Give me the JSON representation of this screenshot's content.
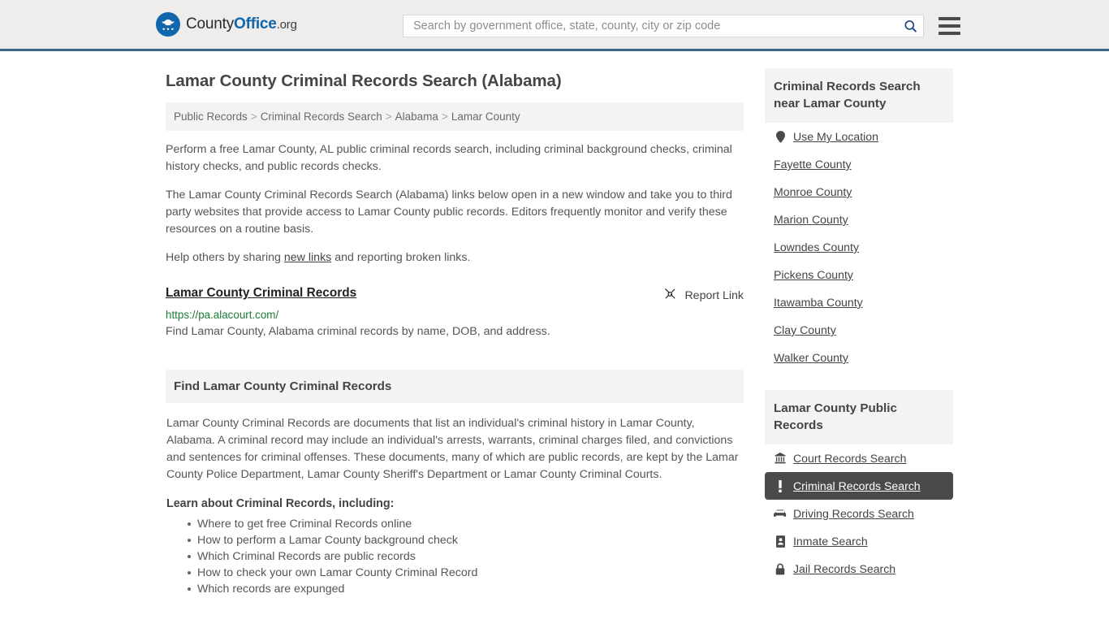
{
  "header": {
    "logo": {
      "icon": "eagle-shield-icon",
      "text_part1": "County",
      "text_part2": "Office",
      "text_part3": ".org"
    },
    "search": {
      "placeholder": "Search by government office, state, county, city or zip code",
      "value": "",
      "search_icon": "search-icon"
    },
    "menu_icon": "hamburger-menu-icon"
  },
  "main": {
    "title": "Lamar County Criminal Records Search (Alabama)",
    "breadcrumb": [
      "Public Records",
      "Criminal Records Search",
      "Alabama",
      "Lamar County"
    ],
    "breadcrumb_separator": ">",
    "intro_paragraph": "Perform a free Lamar County, AL public criminal records search, including criminal background checks, criminal history checks, and public records checks.",
    "second_paragraph": "The Lamar County Criminal Records Search (Alabama) links below open in a new window and take you to third party websites that provide access to Lamar County public records. Editors frequently monitor and verify these resources on a routine basis.",
    "help_prefix": "Help others by sharing ",
    "help_link": "new links",
    "help_suffix": " and reporting broken links.",
    "result": {
      "title": "Lamar County Criminal Records",
      "report_label": "Report Link",
      "report_icon": "broken-link-icon",
      "url": "https://pa.alacourt.com/",
      "description": "Find Lamar County, Alabama criminal records by name, DOB, and address."
    },
    "section": {
      "heading": "Find Lamar County Criminal Records",
      "paragraph": "Lamar County Criminal Records are documents that list an individual's criminal history in Lamar County, Alabama. A criminal record may include an individual's arrests, warrants, criminal charges filed, and convictions and sentences for criminal offenses. These documents, many of which are public records, are kept by the Lamar County Police Department, Lamar County Sheriff's Department or Lamar County Criminal Courts.",
      "learn_heading": "Learn about Criminal Records, including:",
      "learn_items": [
        "Where to get free Criminal Records online",
        "How to perform a Lamar County background check",
        "Which Criminal Records are public records",
        "How to check your own Lamar County Criminal Record",
        "Which records are expunged"
      ]
    }
  },
  "sidebar": {
    "nearby": {
      "heading": "Criminal Records Search near Lamar County",
      "items": [
        {
          "label": "Use My Location",
          "icon": "map-pin-icon",
          "active": false
        },
        {
          "label": "Fayette County",
          "icon": "",
          "active": false
        },
        {
          "label": "Monroe County",
          "icon": "",
          "active": false
        },
        {
          "label": "Marion County",
          "icon": "",
          "active": false
        },
        {
          "label": "Lowndes County",
          "icon": "",
          "active": false
        },
        {
          "label": "Pickens County",
          "icon": "",
          "active": false
        },
        {
          "label": "Itawamba County",
          "icon": "",
          "active": false
        },
        {
          "label": "Clay County",
          "icon": "",
          "active": false
        },
        {
          "label": "Walker County",
          "icon": "",
          "active": false
        }
      ]
    },
    "public_records": {
      "heading": "Lamar County Public Records",
      "items": [
        {
          "label": "Court Records Search",
          "icon": "courthouse-icon",
          "active": false
        },
        {
          "label": "Criminal Records Search",
          "icon": "exclamation-icon",
          "active": true
        },
        {
          "label": "Driving Records Search",
          "icon": "car-icon",
          "active": false
        },
        {
          "label": "Inmate Search",
          "icon": "id-card-icon",
          "active": false
        },
        {
          "label": "Jail Records Search",
          "icon": "lock-icon",
          "active": false
        }
      ]
    }
  },
  "colors": {
    "brand_blue": "#1266ac",
    "header_border": "#35688f",
    "header_bg": "#eeedeb",
    "panel_bg": "#f3f3f3",
    "active_bg": "#4a4a4a",
    "url_green": "#1f7a38"
  }
}
